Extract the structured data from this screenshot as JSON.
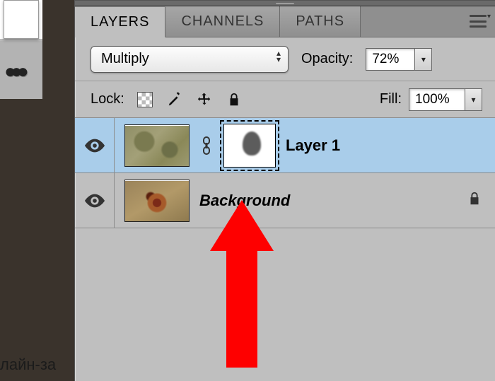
{
  "left": {
    "caption_fragment": "лайн-за"
  },
  "tabs": {
    "layers": "LAYERS",
    "channels": "CHANNELS",
    "paths": "PATHS"
  },
  "blend": {
    "mode": "Multiply"
  },
  "opacity": {
    "label": "Opacity:",
    "value": "72%"
  },
  "lock": {
    "label": "Lock:"
  },
  "fill": {
    "label": "Fill:",
    "value": "100%"
  },
  "layers": {
    "0": {
      "name": "Layer 1"
    },
    "1": {
      "name": "Background"
    }
  }
}
